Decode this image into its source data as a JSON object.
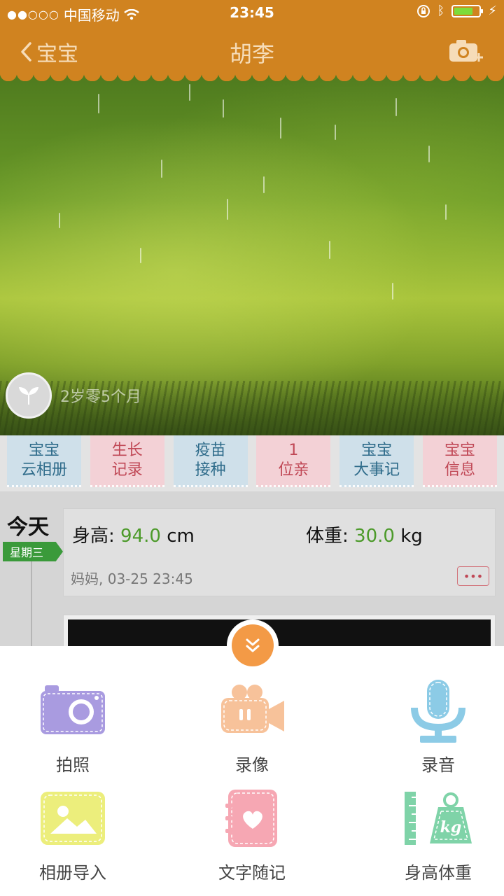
{
  "status": {
    "carrier": "中国移动",
    "time": "23:45"
  },
  "nav": {
    "back_label": "宝宝",
    "title": "胡李"
  },
  "hero": {
    "age_text": "2岁零5个月"
  },
  "tabs": [
    {
      "line1": "宝宝",
      "line2": "云相册"
    },
    {
      "line1": "生长",
      "line2": "记录"
    },
    {
      "line1": "疫苗",
      "line2": "接种"
    },
    {
      "line1": "1",
      "line2": "位亲"
    },
    {
      "line1": "宝宝",
      "line2": "大事记"
    },
    {
      "line1": "宝宝",
      "line2": "信息"
    }
  ],
  "timeline": {
    "today_label": "今天",
    "weekday": "星期三",
    "card": {
      "height_label": "身高:",
      "height_value": "94.0",
      "height_unit": "cm",
      "weight_label": "体重:",
      "weight_value": "30.0",
      "weight_unit": "kg",
      "meta": "妈妈, 03-25 23:45",
      "more": "•••"
    }
  },
  "actions": [
    {
      "label": "拍照",
      "icon": "camera-icon",
      "color": "#a99be0"
    },
    {
      "label": "录像",
      "icon": "video-camera-icon",
      "color": "#f7c29a"
    },
    {
      "label": "录音",
      "icon": "microphone-icon",
      "color": "#8ccbe6"
    },
    {
      "label": "相册导入",
      "icon": "photo-album-icon",
      "color": "#ecee7c"
    },
    {
      "label": "文字随记",
      "icon": "notebook-heart-icon",
      "color": "#f6a7b3"
    },
    {
      "label": "身高体重",
      "icon": "height-weight-icon",
      "color": "#7fd3a8"
    }
  ]
}
